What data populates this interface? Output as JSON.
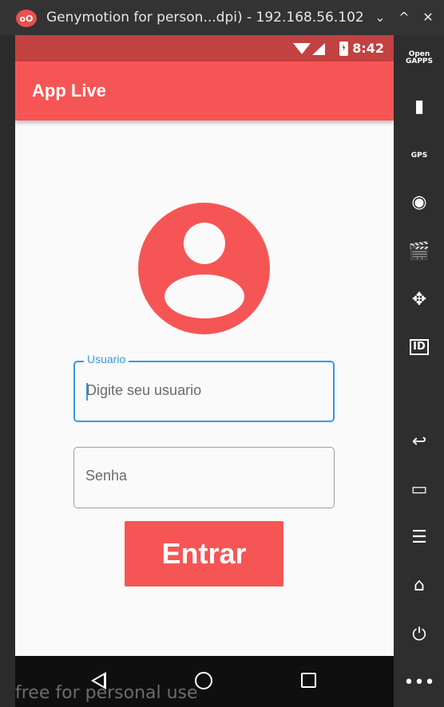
{
  "window": {
    "logo_text": "oO",
    "title": "Genymotion for person...dpi) - 192.168.56.102",
    "controls": [
      "⌄",
      "^",
      "✕"
    ]
  },
  "statusbar": {
    "time": "8:42"
  },
  "appbar": {
    "title": "App Live"
  },
  "login": {
    "username": {
      "label": "Usuario",
      "placeholder": "Digite seu usuario",
      "value": ""
    },
    "password": {
      "placeholder": "Senha",
      "value": ""
    },
    "submit_label": "Entrar"
  },
  "navbar": {
    "watermark": "free for personal use"
  },
  "sidebar": {
    "items": [
      {
        "label": "Open\nGAPPS"
      },
      {
        "label": "▮"
      },
      {
        "label": "GPS"
      },
      {
        "label": "◉"
      },
      {
        "label": "🎬"
      },
      {
        "label": "✥"
      },
      {
        "label": "ID"
      },
      {
        "label": "↩"
      },
      {
        "label": "▭"
      },
      {
        "label": "☰"
      },
      {
        "label": "⌂"
      },
      {
        "label": "⏻"
      },
      {
        "label": "•••"
      }
    ]
  },
  "colors": {
    "primary": "#f65555",
    "status_bar": "#c24141",
    "focus": "#3a98e4",
    "background": "#fafafa"
  }
}
